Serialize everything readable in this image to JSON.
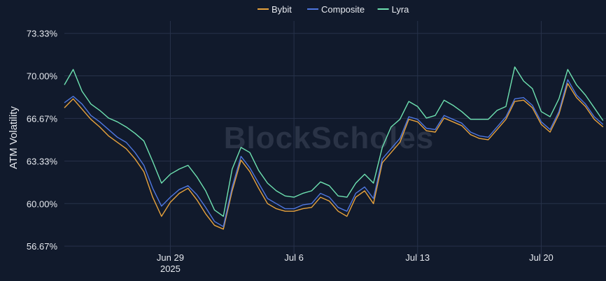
{
  "chart_data": {
    "type": "line",
    "title": "",
    "xlabel": "",
    "ylabel": "ATM Volatility",
    "watermark": "BlockScholes",
    "legend_position": "top-center",
    "grid": true,
    "x_range": [
      "2025-06-23T00:00",
      "2025-07-23T16:00"
    ],
    "ylim": [
      55.8,
      74.3
    ],
    "y_ticks": [
      56.67,
      60.0,
      63.33,
      66.67,
      70.0,
      73.33
    ],
    "y_tick_labels": [
      "56.67%",
      "60.00%",
      "63.33%",
      "66.67%",
      "70.00%",
      "73.33%"
    ],
    "x_ticks": [
      "2025-06-29",
      "2025-07-06",
      "2025-07-13",
      "2025-07-20"
    ],
    "x_tick_labels": [
      "Jun 29",
      "Jul 6",
      "Jul 13",
      "Jul 20"
    ],
    "x_tick_year": "2025",
    "series": [
      {
        "name": "Bybit",
        "color": "#e8a33d",
        "x": [
          "2025-06-23T00:00",
          "2025-06-23T12:00",
          "2025-06-24T00:00",
          "2025-06-24T12:00",
          "2025-06-25T00:00",
          "2025-06-25T12:00",
          "2025-06-26T00:00",
          "2025-06-26T12:00",
          "2025-06-27T00:00",
          "2025-06-27T12:00",
          "2025-06-28T00:00",
          "2025-06-28T12:00",
          "2025-06-29T00:00",
          "2025-06-29T12:00",
          "2025-06-30T00:00",
          "2025-06-30T12:00",
          "2025-07-01T00:00",
          "2025-07-01T12:00",
          "2025-07-02T00:00",
          "2025-07-02T12:00",
          "2025-07-03T00:00",
          "2025-07-03T12:00",
          "2025-07-04T00:00",
          "2025-07-04T12:00",
          "2025-07-05T00:00",
          "2025-07-05T12:00",
          "2025-07-06T00:00",
          "2025-07-06T12:00",
          "2025-07-07T00:00",
          "2025-07-07T12:00",
          "2025-07-08T00:00",
          "2025-07-08T12:00",
          "2025-07-09T00:00",
          "2025-07-09T12:00",
          "2025-07-10T00:00",
          "2025-07-10T12:00",
          "2025-07-11T00:00",
          "2025-07-11T12:00",
          "2025-07-12T00:00",
          "2025-07-12T12:00",
          "2025-07-13T00:00",
          "2025-07-13T12:00",
          "2025-07-14T00:00",
          "2025-07-14T12:00",
          "2025-07-15T00:00",
          "2025-07-15T12:00",
          "2025-07-16T00:00",
          "2025-07-16T12:00",
          "2025-07-17T00:00",
          "2025-07-17T12:00",
          "2025-07-18T00:00",
          "2025-07-18T12:00",
          "2025-07-19T00:00",
          "2025-07-19T12:00",
          "2025-07-20T00:00",
          "2025-07-20T12:00",
          "2025-07-21T00:00",
          "2025-07-21T12:00",
          "2025-07-22T00:00",
          "2025-07-22T12:00",
          "2025-07-23T00:00",
          "2025-07-23T12:00"
        ],
        "values": [
          67.5,
          68.2,
          67.4,
          66.6,
          66.0,
          65.3,
          64.8,
          64.3,
          63.5,
          62.5,
          60.5,
          59.0,
          60.1,
          60.8,
          61.2,
          60.3,
          59.2,
          58.3,
          58.0,
          61.0,
          63.4,
          62.5,
          61.2,
          60.0,
          59.6,
          59.4,
          59.4,
          59.6,
          59.7,
          60.5,
          60.2,
          59.4,
          59.0,
          60.5,
          61.0,
          60.0,
          63.2,
          64.0,
          64.8,
          66.6,
          66.4,
          65.7,
          65.6,
          66.7,
          66.4,
          66.1,
          65.4,
          65.1,
          65.0,
          65.8,
          66.6,
          68.0,
          68.1,
          67.5,
          66.2,
          65.6,
          67.0,
          69.4,
          68.3,
          67.6,
          66.6,
          66.0
        ]
      },
      {
        "name": "Composite",
        "color": "#4f77e0",
        "x": [
          "2025-06-23T00:00",
          "2025-06-23T12:00",
          "2025-06-24T00:00",
          "2025-06-24T12:00",
          "2025-06-25T00:00",
          "2025-06-25T12:00",
          "2025-06-26T00:00",
          "2025-06-26T12:00",
          "2025-06-27T00:00",
          "2025-06-27T12:00",
          "2025-06-28T00:00",
          "2025-06-28T12:00",
          "2025-06-29T00:00",
          "2025-06-29T12:00",
          "2025-06-30T00:00",
          "2025-06-30T12:00",
          "2025-07-01T00:00",
          "2025-07-01T12:00",
          "2025-07-02T00:00",
          "2025-07-02T12:00",
          "2025-07-03T00:00",
          "2025-07-03T12:00",
          "2025-07-04T00:00",
          "2025-07-04T12:00",
          "2025-07-05T00:00",
          "2025-07-05T12:00",
          "2025-07-06T00:00",
          "2025-07-06T12:00",
          "2025-07-07T00:00",
          "2025-07-07T12:00",
          "2025-07-08T00:00",
          "2025-07-08T12:00",
          "2025-07-09T00:00",
          "2025-07-09T12:00",
          "2025-07-10T00:00",
          "2025-07-10T12:00",
          "2025-07-11T00:00",
          "2025-07-11T12:00",
          "2025-07-12T00:00",
          "2025-07-12T12:00",
          "2025-07-13T00:00",
          "2025-07-13T12:00",
          "2025-07-14T00:00",
          "2025-07-14T12:00",
          "2025-07-15T00:00",
          "2025-07-15T12:00",
          "2025-07-16T00:00",
          "2025-07-16T12:00",
          "2025-07-17T00:00",
          "2025-07-17T12:00",
          "2025-07-18T00:00",
          "2025-07-18T12:00",
          "2025-07-19T00:00",
          "2025-07-19T12:00",
          "2025-07-20T00:00",
          "2025-07-20T12:00",
          "2025-07-21T00:00",
          "2025-07-21T12:00",
          "2025-07-22T00:00",
          "2025-07-22T12:00",
          "2025-07-23T00:00",
          "2025-07-23T12:00"
        ],
        "values": [
          67.9,
          68.4,
          67.8,
          66.9,
          66.4,
          65.8,
          65.2,
          64.8,
          64.0,
          63.0,
          61.2,
          59.8,
          60.5,
          61.1,
          61.4,
          60.7,
          59.7,
          58.6,
          58.2,
          61.3,
          63.7,
          62.8,
          61.6,
          60.4,
          60.0,
          59.6,
          59.6,
          59.9,
          60.0,
          60.8,
          60.5,
          59.7,
          59.4,
          60.8,
          61.3,
          60.4,
          63.5,
          64.3,
          65.1,
          66.8,
          66.6,
          65.9,
          65.8,
          66.9,
          66.6,
          66.3,
          65.6,
          65.3,
          65.2,
          66.0,
          66.8,
          68.2,
          68.3,
          67.7,
          66.4,
          65.8,
          67.2,
          69.7,
          68.5,
          67.8,
          66.8,
          66.2
        ]
      },
      {
        "name": "Lyra",
        "color": "#6ee2b1",
        "x": [
          "2025-06-23T00:00",
          "2025-06-23T12:00",
          "2025-06-24T00:00",
          "2025-06-24T12:00",
          "2025-06-25T00:00",
          "2025-06-25T12:00",
          "2025-06-26T00:00",
          "2025-06-26T12:00",
          "2025-06-27T00:00",
          "2025-06-27T12:00",
          "2025-06-28T00:00",
          "2025-06-28T12:00",
          "2025-06-29T00:00",
          "2025-06-29T12:00",
          "2025-06-30T00:00",
          "2025-06-30T12:00",
          "2025-07-01T00:00",
          "2025-07-01T12:00",
          "2025-07-02T00:00",
          "2025-07-02T12:00",
          "2025-07-03T00:00",
          "2025-07-03T12:00",
          "2025-07-04T00:00",
          "2025-07-04T12:00",
          "2025-07-05T00:00",
          "2025-07-05T12:00",
          "2025-07-06T00:00",
          "2025-07-06T12:00",
          "2025-07-07T00:00",
          "2025-07-07T12:00",
          "2025-07-08T00:00",
          "2025-07-08T12:00",
          "2025-07-09T00:00",
          "2025-07-09T12:00",
          "2025-07-10T00:00",
          "2025-07-10T12:00",
          "2025-07-11T00:00",
          "2025-07-11T12:00",
          "2025-07-12T00:00",
          "2025-07-12T12:00",
          "2025-07-13T00:00",
          "2025-07-13T12:00",
          "2025-07-14T00:00",
          "2025-07-14T12:00",
          "2025-07-15T00:00",
          "2025-07-15T12:00",
          "2025-07-16T00:00",
          "2025-07-16T12:00",
          "2025-07-17T00:00",
          "2025-07-17T12:00",
          "2025-07-18T00:00",
          "2025-07-18T12:00",
          "2025-07-19T00:00",
          "2025-07-19T12:00",
          "2025-07-20T00:00",
          "2025-07-20T12:00",
          "2025-07-21T00:00",
          "2025-07-21T12:00",
          "2025-07-22T00:00",
          "2025-07-22T12:00",
          "2025-07-23T00:00",
          "2025-07-23T12:00"
        ],
        "values": [
          69.3,
          70.5,
          68.8,
          67.8,
          67.3,
          66.7,
          66.4,
          66.0,
          65.5,
          64.9,
          63.3,
          61.6,
          62.3,
          62.7,
          63.0,
          62.1,
          61.0,
          59.5,
          59.0,
          62.7,
          64.4,
          64.0,
          62.6,
          61.6,
          61.0,
          60.6,
          60.5,
          60.8,
          61.0,
          61.7,
          61.4,
          60.6,
          60.5,
          61.6,
          62.3,
          61.6,
          64.4,
          66.0,
          66.6,
          68.0,
          67.6,
          66.7,
          66.9,
          68.1,
          67.7,
          67.2,
          66.6,
          66.6,
          66.6,
          67.3,
          67.6,
          70.7,
          69.6,
          69.0,
          67.2,
          66.8,
          68.2,
          70.5,
          69.3,
          68.5,
          67.5,
          66.5
        ]
      }
    ]
  }
}
